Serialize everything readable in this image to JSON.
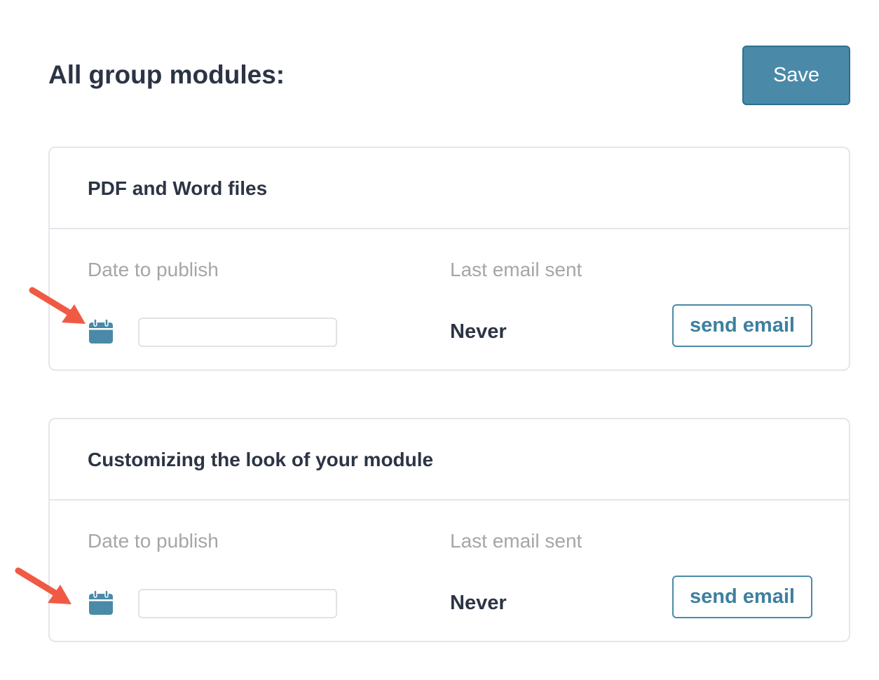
{
  "header": {
    "title": "All group modules:",
    "save_label": "Save"
  },
  "modules": [
    {
      "title": "PDF and Word files",
      "date_label": "Date to publish",
      "date_value": "",
      "last_email_label": "Last email sent",
      "last_email_value": "Never",
      "send_email_label": "send email"
    },
    {
      "title": "Customizing the look of your module",
      "date_label": "Date to publish",
      "date_value": "",
      "last_email_label": "Last email sent",
      "last_email_value": "Never",
      "send_email_label": "send email"
    }
  ],
  "icons": {
    "calendar": "calendar-icon",
    "annotation": "red-arrow-icon"
  },
  "colors": {
    "accent": "#4a8aa8",
    "annotation": "#f05a45",
    "title": "#2c3444",
    "muted_label": "#a6a6a6"
  }
}
